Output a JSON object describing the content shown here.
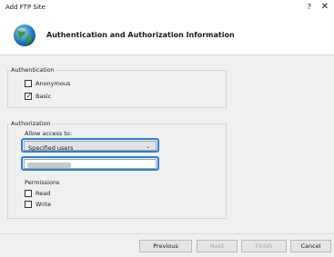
{
  "window": {
    "title": "Add FTP Site",
    "help_label": "?",
    "close_label": "✕"
  },
  "header": {
    "title": "Authentication and Authorization Information"
  },
  "authentication": {
    "group_label": "Authentication",
    "anonymous": {
      "label": "Anonymous",
      "checked": false,
      "check_glyph": ""
    },
    "basic": {
      "label": "Basic",
      "checked": true,
      "check_glyph": "✓"
    }
  },
  "authorization": {
    "group_label": "Authorization",
    "allow_access_label": "Allow access to:",
    "allow_access_value": "Specified users",
    "users_value_hidden": true
  },
  "permissions": {
    "label": "Permissions",
    "read": {
      "label": "Read",
      "checked": false
    },
    "write": {
      "label": "Write",
      "checked": false
    }
  },
  "buttons": {
    "previous": "Previous",
    "next": "Next",
    "finish": "Finish",
    "cancel": "Cancel"
  },
  "colors": {
    "focus_highlight": "#2f7fd6"
  }
}
